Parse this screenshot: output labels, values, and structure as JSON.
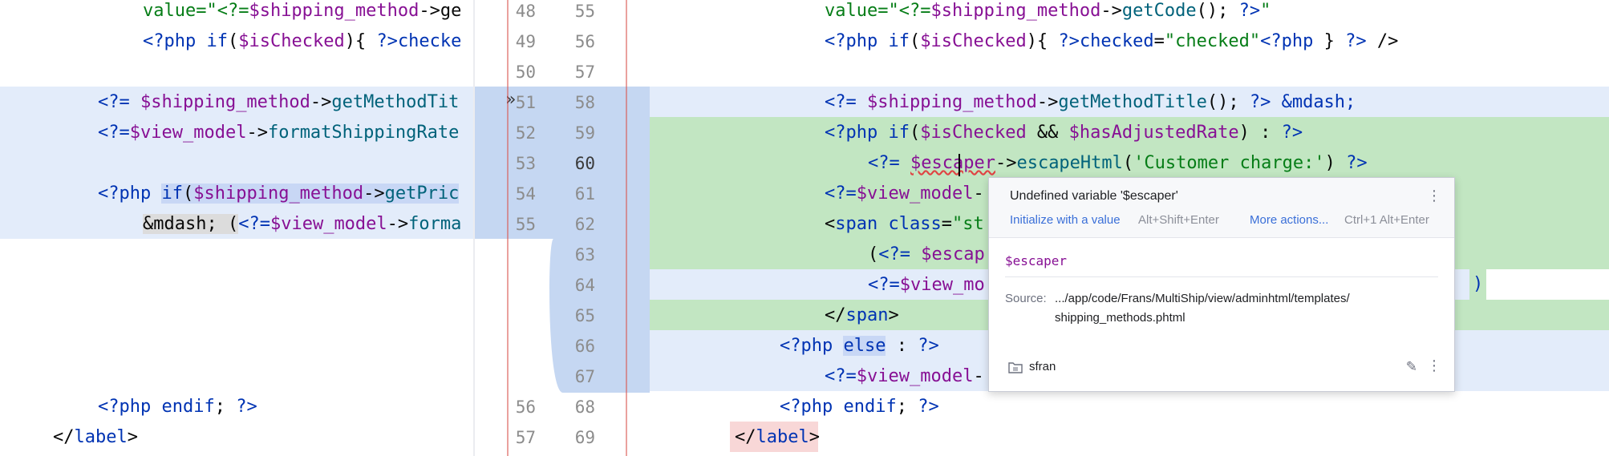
{
  "left": {
    "lines": [
      {
        "segs": [
          {
            "c": "s",
            "t": "value=\"<?="
          },
          {
            "c": "v",
            "t": "$shipping_method"
          },
          {
            "c": "",
            "t": "->ge"
          }
        ]
      },
      {
        "segs": [
          {
            "c": "k",
            "t": "<?php "
          },
          {
            "c": "k",
            "t": "if"
          },
          {
            "c": "",
            "t": "("
          },
          {
            "c": "v",
            "t": "$isChecked"
          },
          {
            "c": "",
            "t": "){ "
          },
          {
            "c": "k",
            "t": "?>"
          },
          {
            "c": "t",
            "t": "checke"
          }
        ]
      },
      {
        "segs": []
      },
      {
        "segs": [
          {
            "c": "k",
            "t": "<?= "
          },
          {
            "c": "v",
            "t": "$shipping_method"
          },
          {
            "c": "",
            "t": "->"
          },
          {
            "c": "f",
            "t": "getMethodTit"
          }
        ]
      },
      {
        "segs": [
          {
            "c": "k",
            "t": "<?="
          },
          {
            "c": "v",
            "t": "$view_model"
          },
          {
            "c": "",
            "t": "->"
          },
          {
            "c": "f",
            "t": "formatShippingRate"
          }
        ]
      },
      {
        "segs": []
      },
      {
        "segs": [
          {
            "c": "k",
            "t": "<?php "
          },
          {
            "c": "k",
            "t": "if"
          },
          {
            "c": "",
            "t": "("
          },
          {
            "c": "v",
            "t": "$shipping_method"
          },
          {
            "c": "",
            "t": "->"
          },
          {
            "c": "f",
            "t": "getPric"
          }
        ]
      },
      {
        "segs": [
          {
            "c": "",
            "t": "&mdash; ("
          },
          {
            "c": "k",
            "t": "<?="
          },
          {
            "c": "v",
            "t": "$view_model"
          },
          {
            "c": "",
            "t": "->"
          },
          {
            "c": "f",
            "t": "forma"
          }
        ]
      },
      {
        "segs": []
      },
      {
        "segs": []
      },
      {
        "segs": []
      },
      {
        "segs": []
      },
      {
        "segs": []
      },
      {
        "segs": [
          {
            "c": "k",
            "t": "<?php "
          },
          {
            "c": "k",
            "t": "endif"
          },
          {
            "c": "",
            "t": "; "
          },
          {
            "c": "k",
            "t": "?>"
          }
        ]
      },
      {
        "segs": [
          {
            "c": "",
            "t": "</"
          },
          {
            "c": "t",
            "t": "label"
          },
          {
            "c": "",
            "t": ">"
          }
        ]
      }
    ]
  },
  "gutter": {
    "left_numbers": [
      "48",
      "49",
      "50",
      "51",
      "52",
      "53",
      "54",
      "55",
      "",
      "",
      "",
      "",
      "",
      "56",
      "57"
    ],
    "right_numbers": [
      "55",
      "56",
      "57",
      "58",
      "59",
      "60",
      "61",
      "62",
      "63",
      "64",
      "65",
      "66",
      "67",
      "68",
      "69"
    ],
    "current_line": "60"
  },
  "right": {
    "lines": [
      {
        "segs": [
          {
            "c": "s",
            "t": "value=\"<?="
          },
          {
            "c": "v",
            "t": "$shipping_method"
          },
          {
            "c": "",
            "t": "->"
          },
          {
            "c": "f",
            "t": "getCode"
          },
          {
            "c": "",
            "t": "(); "
          },
          {
            "c": "k",
            "t": "?>"
          },
          {
            "c": "s",
            "t": "\""
          }
        ]
      },
      {
        "segs": [
          {
            "c": "k",
            "t": "<?php "
          },
          {
            "c": "k",
            "t": "if"
          },
          {
            "c": "",
            "t": "("
          },
          {
            "c": "v",
            "t": "$isChecked"
          },
          {
            "c": "",
            "t": "){ "
          },
          {
            "c": "k",
            "t": "?>"
          },
          {
            "c": "t",
            "t": "checked"
          },
          {
            "c": "",
            "t": "="
          },
          {
            "c": "s",
            "t": "\"checked\""
          },
          {
            "c": "k",
            "t": "<?php "
          },
          {
            "c": "",
            "t": "} "
          },
          {
            "c": "k",
            "t": "?>"
          },
          {
            "c": "",
            "t": " />"
          }
        ]
      },
      {
        "segs": []
      },
      {
        "segs": [
          {
            "c": "k",
            "t": "<?= "
          },
          {
            "c": "v",
            "t": "$shipping_method"
          },
          {
            "c": "",
            "t": "->"
          },
          {
            "c": "f",
            "t": "getMethodTitle"
          },
          {
            "c": "",
            "t": "(); "
          },
          {
            "c": "k",
            "t": "?>"
          },
          {
            "c": "",
            "t": " "
          },
          {
            "c": "k",
            "t": "&mdash;"
          }
        ]
      },
      {
        "segs": [
          {
            "c": "k",
            "t": "<?php "
          },
          {
            "c": "k",
            "t": "if"
          },
          {
            "c": "",
            "t": "("
          },
          {
            "c": "v",
            "t": "$isChecked"
          },
          {
            "c": "",
            "t": " && "
          },
          {
            "c": "v",
            "t": "$hasAdjustedRate"
          },
          {
            "c": "",
            "t": ") : "
          },
          {
            "c": "k",
            "t": "?>"
          }
        ]
      },
      {
        "segs": [
          {
            "c": "k",
            "t": "<?= "
          },
          {
            "c": "v",
            "t": "$escaper"
          },
          {
            "c": "",
            "t": "->"
          },
          {
            "c": "f",
            "t": "escapeHtml"
          },
          {
            "c": "",
            "t": "("
          },
          {
            "c": "s",
            "t": "'Customer charge:'"
          },
          {
            "c": "",
            "t": ") "
          },
          {
            "c": "k",
            "t": "?>"
          }
        ]
      },
      {
        "segs": [
          {
            "c": "k",
            "t": "<?="
          },
          {
            "c": "v",
            "t": "$view_model"
          },
          {
            "c": "",
            "t": "-"
          }
        ]
      },
      {
        "segs": [
          {
            "c": "",
            "t": "<"
          },
          {
            "c": "t",
            "t": "span "
          },
          {
            "c": "t",
            "t": "class"
          },
          {
            "c": "",
            "t": "="
          },
          {
            "c": "s",
            "t": "\"st"
          }
        ]
      },
      {
        "segs": [
          {
            "c": "",
            "t": "("
          },
          {
            "c": "k",
            "t": "<?= "
          },
          {
            "c": "v",
            "t": "$escap"
          }
        ]
      },
      {
        "segs": [
          {
            "c": "k",
            "t": "<?="
          },
          {
            "c": "v",
            "t": "$view_mo"
          }
        ]
      },
      {
        "segs": [
          {
            "c": "",
            "t": "</"
          },
          {
            "c": "t",
            "t": "span"
          },
          {
            "c": "",
            "t": ">"
          }
        ]
      },
      {
        "segs": [
          {
            "c": "k",
            "t": "<?php "
          },
          {
            "c": "k",
            "t": "else"
          },
          {
            "c": "",
            "t": " : "
          },
          {
            "c": "k",
            "t": "?>"
          }
        ]
      },
      {
        "segs": [
          {
            "c": "k",
            "t": "<?="
          },
          {
            "c": "v",
            "t": "$view_model"
          },
          {
            "c": "",
            "t": "-"
          }
        ]
      },
      {
        "segs": [
          {
            "c": "k",
            "t": "<?php "
          },
          {
            "c": "k",
            "t": "endif"
          },
          {
            "c": "",
            "t": "; "
          },
          {
            "c": "k",
            "t": "?>"
          }
        ]
      },
      {
        "segs": [
          {
            "c": "",
            "t": "</"
          },
          {
            "c": "t",
            "t": "label"
          },
          {
            "c": "",
            "t": ">"
          }
        ]
      }
    ],
    "trailing_fragment": ")"
  },
  "popup": {
    "title": "Undefined variable '$escaper'",
    "action1": "Initialize with a value",
    "shortcut1": "Alt+Shift+Enter",
    "action2": "More actions...",
    "shortcut2": "Ctrl+1 Alt+Enter",
    "variable": "$escaper",
    "source_label": "Source:",
    "source_line1": ".../app/code/Frans/MultiShip/view/adminhtml/templates/",
    "source_line2": "shipping_methods.phtml",
    "user": "sfran",
    "kebab": "⋮",
    "pencil": "✎"
  },
  "colors": {
    "changed_blue": "#c5d7f2",
    "changed_blue_light": "#e3ecfa",
    "inserted_green": "#c2e6c2",
    "removed_red": "#f8d7d7"
  },
  "icons": [
    "merge-arrow-icon",
    "folder-icon",
    "pencil-icon",
    "kebab-icon"
  ]
}
